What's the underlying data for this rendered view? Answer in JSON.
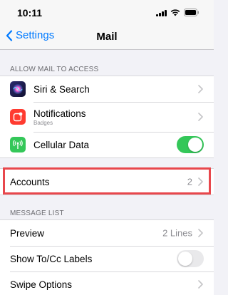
{
  "status_bar": {
    "time": "10:11"
  },
  "nav": {
    "back_label": "Settings",
    "title": "Mail"
  },
  "allow_section": {
    "header": "ALLOW MAIL TO ACCESS",
    "items": [
      {
        "label": "Siri & Search",
        "icon": "siri-icon"
      },
      {
        "label": "Notifications",
        "sublabel": "Badges",
        "icon": "notifications-icon"
      },
      {
        "label": "Cellular Data",
        "icon": "cellular-icon",
        "toggle": true
      }
    ]
  },
  "accounts": {
    "label": "Accounts",
    "value": "2"
  },
  "message_list": {
    "header": "MESSAGE LIST",
    "items": [
      {
        "label": "Preview",
        "value": "2 Lines"
      },
      {
        "label": "Show To/Cc Labels",
        "toggle": false
      },
      {
        "label": "Swipe Options"
      }
    ]
  },
  "colors": {
    "accent": "#007aff",
    "toggle_on": "#34c759",
    "highlight": "#e8474c",
    "notification": "#ff3b30"
  }
}
